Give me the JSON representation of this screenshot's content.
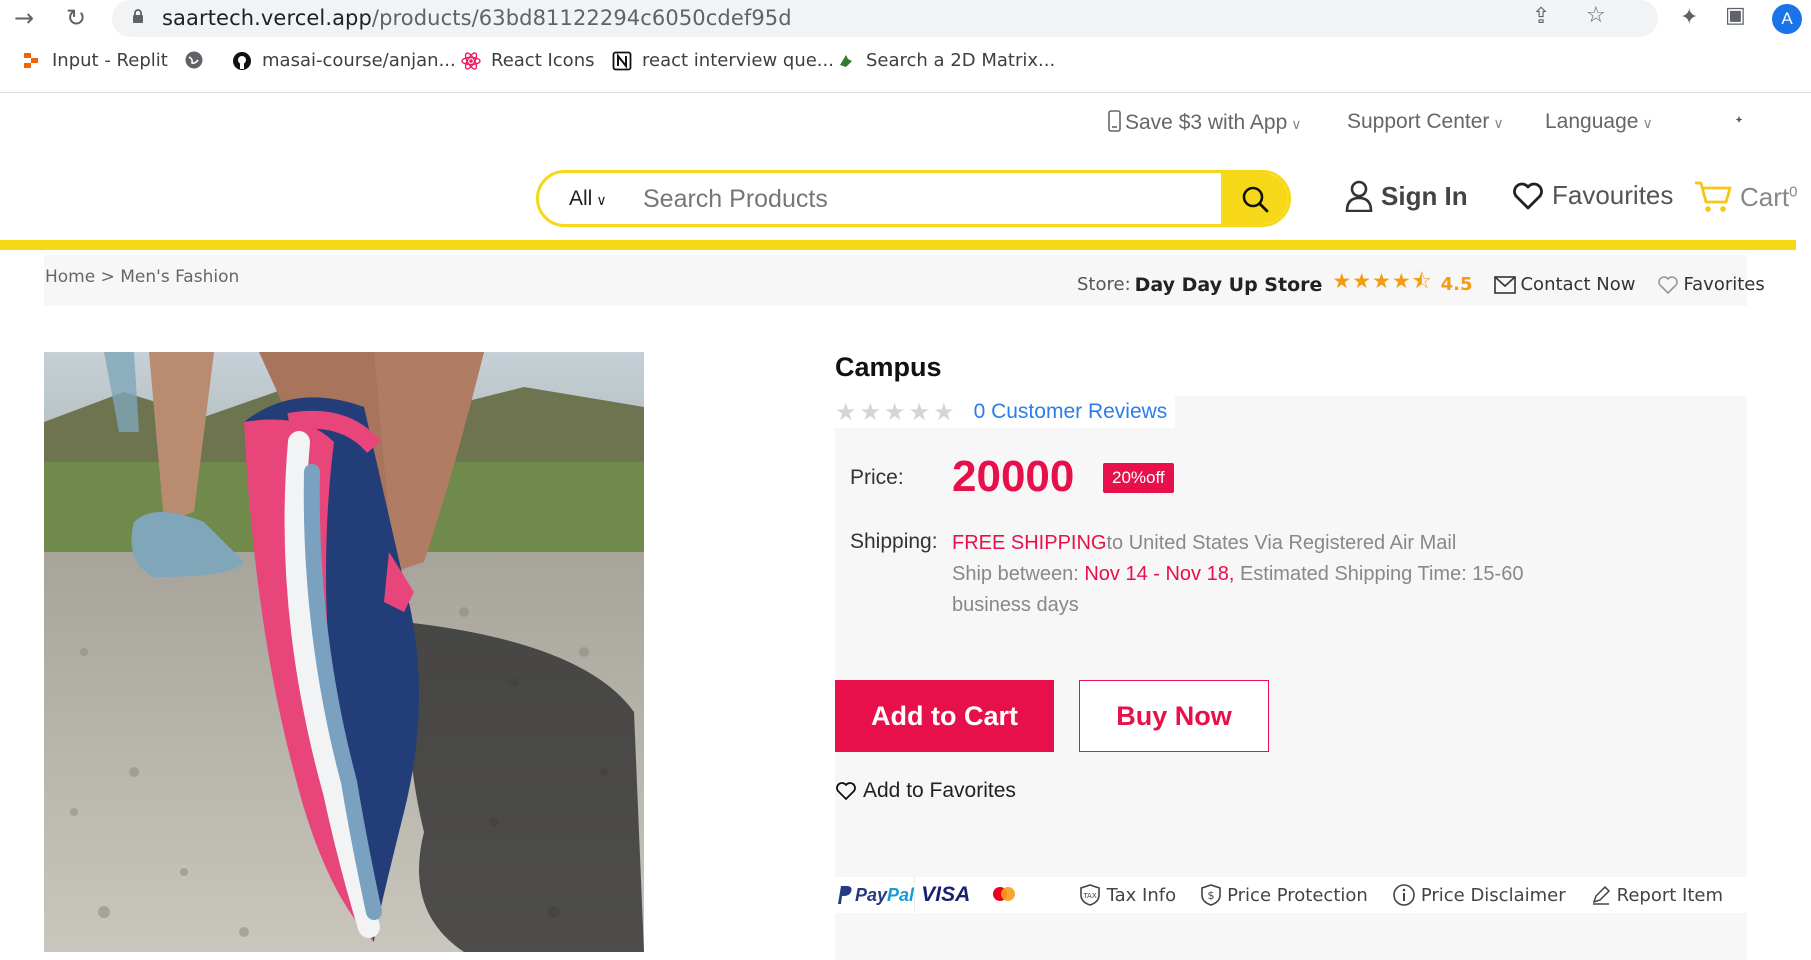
{
  "browser": {
    "url_host": "saartech.vercel.app",
    "url_path": "/products/63bd81122294c6050cdef95d",
    "profile_initial": "A",
    "bookmarks": [
      {
        "label": "Input - Replit"
      },
      {
        "label": ""
      },
      {
        "label": "masai-course/anjan..."
      },
      {
        "label": "React Icons"
      },
      {
        "label": "react interview que..."
      },
      {
        "label": "Search a 2D Matrix..."
      }
    ]
  },
  "header": {
    "top_links": [
      "Save $3 with App",
      "Support Center",
      "Language"
    ],
    "search": {
      "category": "All",
      "placeholder": "Search Products"
    },
    "sign_in": "Sign In",
    "favourites": "Favourites",
    "cart": {
      "label": "Cart",
      "count": "0"
    }
  },
  "breadcrumb": {
    "text": "Home > Men's Fashion"
  },
  "store": {
    "label": "Store:",
    "name": "Day Day Up Store",
    "rating": "4.5",
    "contact": "Contact Now",
    "favorites": "Favorites"
  },
  "product": {
    "title": "Campus",
    "reviews": "0 Customer Reviews",
    "rating_stars": 0,
    "price_label": "Price:",
    "price": "20000",
    "discount": "20%off",
    "shipping_label": "Shipping:",
    "shipping_free": "FREE SHIPPING",
    "shipping_rest": "to United States Via Registered Air Mail",
    "ship_between_label": "Ship between:",
    "ship_dates": "Nov 14 - Nov 18,",
    "ship_time": "Estimated Shipping Time: 15-60 business days",
    "add_to_cart": "Add to Cart",
    "buy_now": "Buy Now",
    "add_to_favorites": "Add to Favorites"
  },
  "payment": {
    "paypal_a": "Pay",
    "paypal_b": "Pal",
    "visa": "VISA",
    "links": [
      "Tax Info",
      "Price Protection",
      "Price Disclaimer",
      "Report Item"
    ]
  },
  "colors": {
    "accent_yellow": "#f7d818",
    "accent_red": "#e8104a",
    "link_blue": "#2b7de9",
    "star_orange": "#f39c12"
  }
}
